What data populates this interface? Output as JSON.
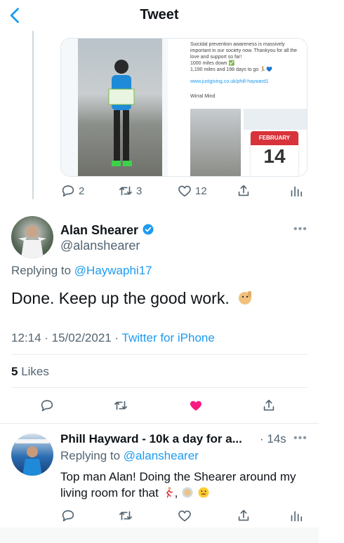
{
  "header": {
    "title": "Tweet"
  },
  "media": {
    "lines": [
      "Suicidal prevention awareness is massively important in our society now. Thankyou for all the love and support so far!",
      "1000 miles down ✅",
      "1,190 miles and 198 days to go 🏃💙"
    ],
    "link": "www.justgiving.co.uk/phill-hayward1",
    "charity": "Wirral Mind",
    "calendar_month": "FEBRUARY",
    "calendar_day": "14"
  },
  "parent_actions": {
    "replies": "2",
    "retweets": "3",
    "likes": "12"
  },
  "tweet": {
    "name": "Alan Shearer",
    "handle": "@alanshearer",
    "replying_prefix": "Replying to ",
    "replying_handle": "@Haywaphi17",
    "text": "Done. Keep up the good work.",
    "time_date": "12:14 · 15/02/2021 · ",
    "source": "Twitter for iPhone",
    "likes_count": "5",
    "likes_label": " Likes"
  },
  "reply": {
    "name": "Phill Hayward - 10k a day for a...",
    "time": "· 14s",
    "replying_prefix": "Replying to ",
    "replying_handle": "@alanshearer",
    "text": "Top man Alan! Doing the Shearer around my living room for that"
  },
  "colors": {
    "accent": "#1d9bf0",
    "like": "#f91880",
    "muted": "#536471"
  }
}
